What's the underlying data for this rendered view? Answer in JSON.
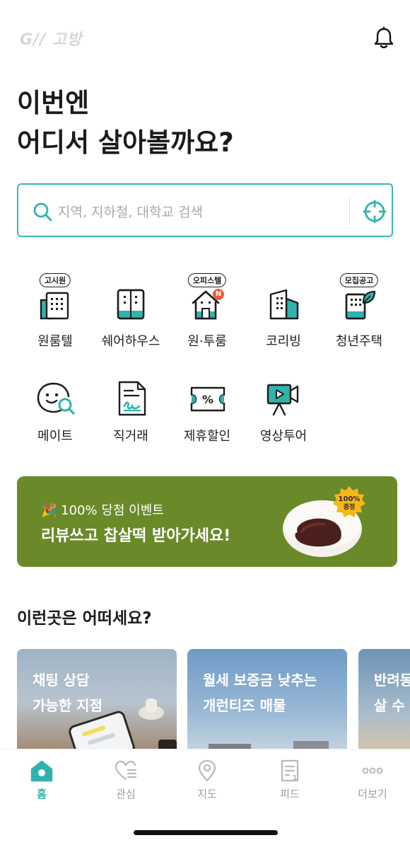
{
  "header": {
    "logo_text": "G// 고방"
  },
  "headline": {
    "line1": "이번엔",
    "line2": "어디서 살아볼까요?"
  },
  "search": {
    "placeholder": "지역, 지하철, 대학교 검색",
    "value": ""
  },
  "categories": [
    {
      "label": "원룸텔",
      "badge": "고시원",
      "icon": "gosiwon-building-icon"
    },
    {
      "label": "쉐어하우스",
      "badge": "",
      "icon": "sharehouse-building-icon"
    },
    {
      "label": "원·투룸",
      "badge": "오피스텔",
      "icon": "house-icon",
      "new_badge": "N"
    },
    {
      "label": "코리빙",
      "badge": "",
      "icon": "coliving-building-icon"
    },
    {
      "label": "청년주택",
      "badge": "모집공고",
      "icon": "youth-housing-icon"
    },
    {
      "label": "메이트",
      "badge": "",
      "icon": "mate-smile-search-icon"
    },
    {
      "label": "직거래",
      "badge": "",
      "icon": "contract-document-icon"
    },
    {
      "label": "제휴할인",
      "badge": "",
      "icon": "discount-ticket-icon"
    },
    {
      "label": "영상투어",
      "badge": "",
      "icon": "video-camera-icon"
    }
  ],
  "banner": {
    "subtitle": "🎉 100% 당첨 이벤트",
    "title": "리뷰쓰고 찹살떡 받아가세요!",
    "sticker_line1": "100%",
    "sticker_line2": "증정",
    "bg_color": "#6a8a2a"
  },
  "section": {
    "title": "이런곳은 어떠세요?"
  },
  "cards": [
    {
      "line1": "채팅 상담",
      "line2": "가능한 지점"
    },
    {
      "line1": "월세 보증금 낮추는",
      "line2": "개런티즈 매물"
    },
    {
      "line1": "반려동",
      "line2": "살 수"
    }
  ],
  "tabbar": [
    {
      "label": "홈",
      "icon": "home-icon",
      "active": true
    },
    {
      "label": "관심",
      "icon": "heart-list-icon",
      "active": false
    },
    {
      "label": "지도",
      "icon": "map-pin-icon",
      "active": false
    },
    {
      "label": "피드",
      "icon": "feed-document-icon",
      "active": false
    },
    {
      "label": "더보기",
      "icon": "more-dots-icon",
      "active": false
    }
  ],
  "colors": {
    "accent": "#2fb3ad",
    "search_border": "#38b8b2",
    "banner_bg": "#6a8a2a"
  }
}
